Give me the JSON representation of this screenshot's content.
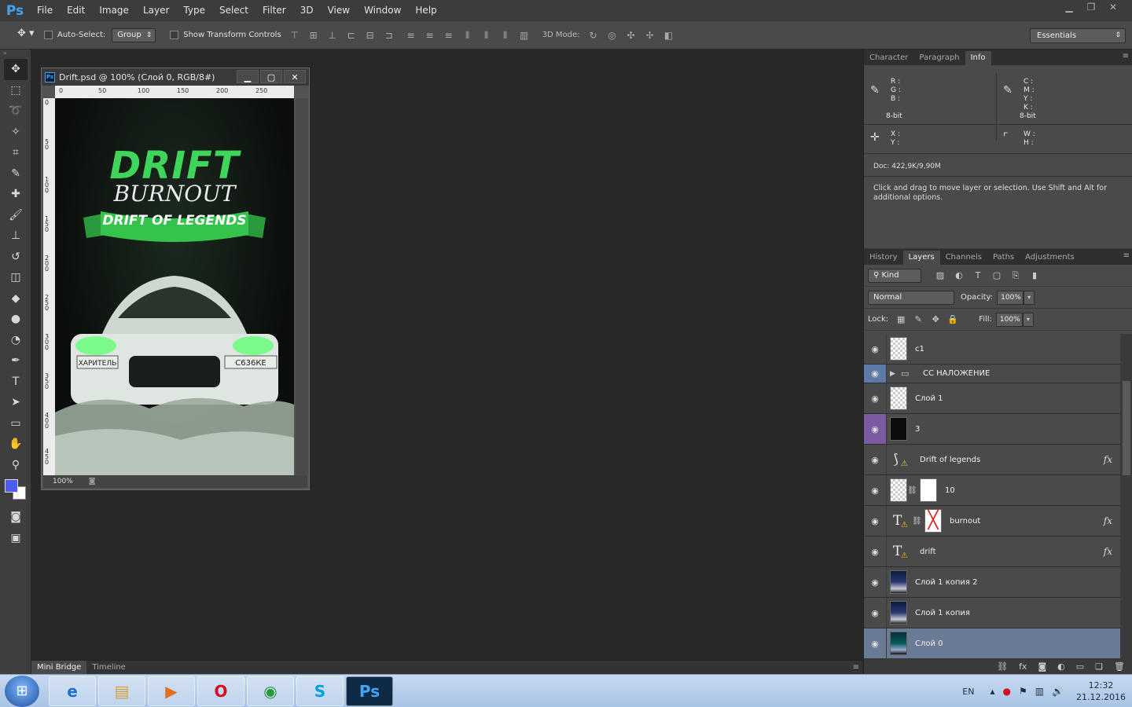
{
  "app": {
    "logo": "Ps"
  },
  "menu": [
    "File",
    "Edit",
    "Image",
    "Layer",
    "Type",
    "Select",
    "Filter",
    "3D",
    "View",
    "Window",
    "Help"
  ],
  "options": {
    "auto_select_label": "Auto-Select:",
    "auto_select_value": "Group",
    "show_transform_label": "Show Transform Controls",
    "mode_3d_label": "3D Mode:",
    "workspace": "Essentials"
  },
  "document": {
    "title": "Drift.psd @ 100% (Слой 0, RGB/8#)",
    "zoom": "100%",
    "ruler_h": [
      "0",
      "50",
      "100",
      "150",
      "200",
      "250"
    ],
    "ruler_v": [
      "0",
      "50",
      "100",
      "150",
      "200",
      "250",
      "300",
      "350",
      "400",
      "450"
    ]
  },
  "poster": {
    "title1": "DRIFT",
    "title2": "BURNOUT",
    "banner": "DRIFT OF LEGENDS",
    "plate_left": "ХАРИТЕЛЬ",
    "plate_right": "С636КЕ"
  },
  "info_panel": {
    "tabs": [
      "Character",
      "Paragraph",
      "Info"
    ],
    "active_tab": "Info",
    "rgb_labels": [
      "R :",
      "G :",
      "B :"
    ],
    "rgb_bits": "8-bit",
    "cmyk_labels": [
      "C :",
      "M :",
      "Y :",
      "K :"
    ],
    "cmyk_bits": "8-bit",
    "xy_labels": [
      "X :",
      "Y :"
    ],
    "wh_labels": [
      "W :",
      "H :"
    ],
    "doc_size": "Doc: 422,9K/9,90M",
    "hint": "Click and drag to move layer or selection.  Use Shift and Alt for additional options."
  },
  "layers_panel": {
    "tabs": [
      "History",
      "Layers",
      "Channels",
      "Paths",
      "Adjustments"
    ],
    "active_tab": "Layers",
    "kind_label": "Kind",
    "blend_mode": "Normal",
    "opacity_label": "Opacity:",
    "opacity_value": "100%",
    "lock_label": "Lock:",
    "fill_label": "Fill:",
    "fill_value": "100%",
    "layers": [
      {
        "name": "c1"
      },
      {
        "name": "СС НАЛОЖЕНИЕ"
      },
      {
        "name": "Слой 1"
      },
      {
        "name": "3"
      },
      {
        "name": "Drift of legends"
      },
      {
        "name": "10"
      },
      {
        "name": "burnout"
      },
      {
        "name": "drift"
      },
      {
        "name": "Слой 1 копия 2"
      },
      {
        "name": "Слой 1 копия"
      },
      {
        "name": "Слой 0"
      }
    ]
  },
  "bottom_tabs": [
    "Mini Bridge",
    "Timeline"
  ],
  "taskbar": {
    "lang": "EN",
    "time": "12:32",
    "date": "21.12.2016"
  }
}
